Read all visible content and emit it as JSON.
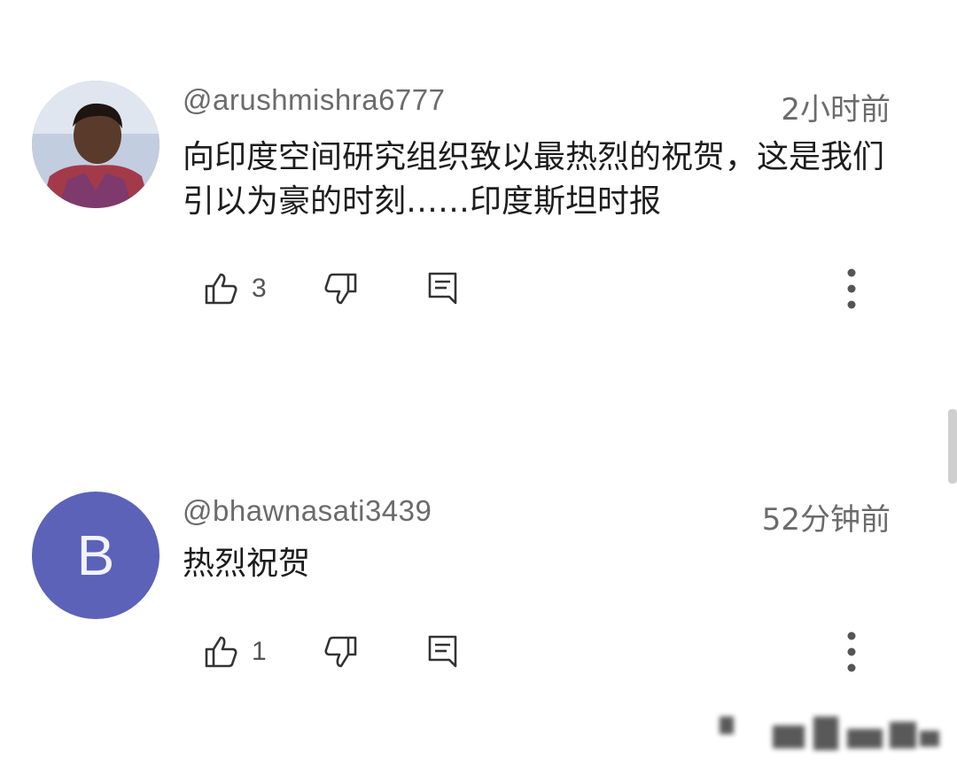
{
  "comments": [
    {
      "handle": "@arushmishra6777",
      "time": "2小时前",
      "text": "向印度空间研究组织致以最热烈的祝贺，这是我们引以为豪的时刻……印度斯坦时报",
      "like_count": "3"
    },
    {
      "handle": "@bhawnasati3439",
      "time": "52分钟前",
      "avatar_letter": "B",
      "text": "热烈祝贺",
      "like_count": "1"
    }
  ],
  "icons": [
    "thumbs-up-icon",
    "thumbs-down-icon",
    "reply-icon",
    "more-vertical-icon"
  ],
  "colors": {
    "avatar_b": "#5b62b8",
    "secondary_text": "#6b6b6b",
    "primary_text": "#1d1d1d"
  }
}
